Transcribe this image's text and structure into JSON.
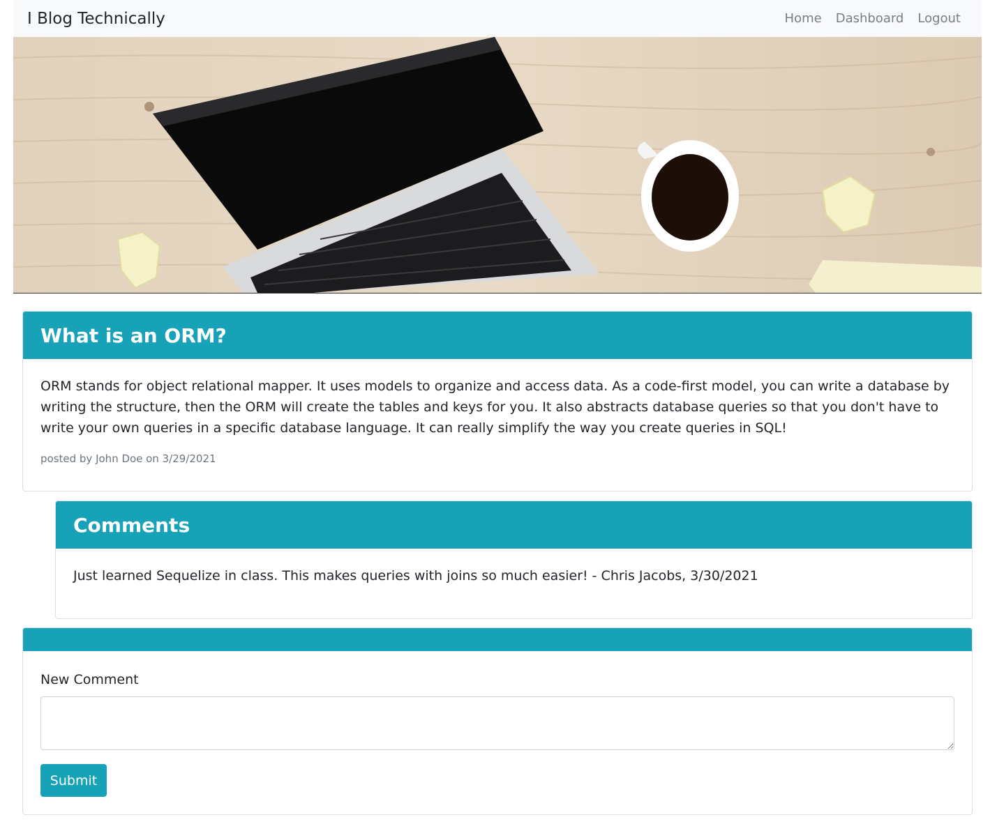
{
  "navbar": {
    "brand": "I Blog Technically",
    "links": [
      "Home",
      "Dashboard",
      "Logout"
    ]
  },
  "post": {
    "title": "What is an ORM?",
    "body": "ORM stands for object relational mapper. It uses models to organize and access data. As a code-first model, you can write a database by writing the structure, then the ORM will create the tables and keys for you. It also abstracts database queries so that you don't have to write your own queries in a specific database language. It can really simplify the way you create queries in SQL!",
    "meta": "posted by John Doe on 3/29/2021"
  },
  "comments": {
    "title": "Comments",
    "items": [
      "Just learned Sequelize in class. This makes queries with joins so much easier! - Chris Jacobs, 3/30/2021"
    ]
  },
  "new_comment": {
    "label": "New Comment",
    "value": "",
    "submit_label": "Submit"
  },
  "colors": {
    "accent": "#17a2b8",
    "navbar_bg": "#f8f9fa"
  },
  "icons": {
    "hero": "laptop-coffee-desk-image"
  }
}
